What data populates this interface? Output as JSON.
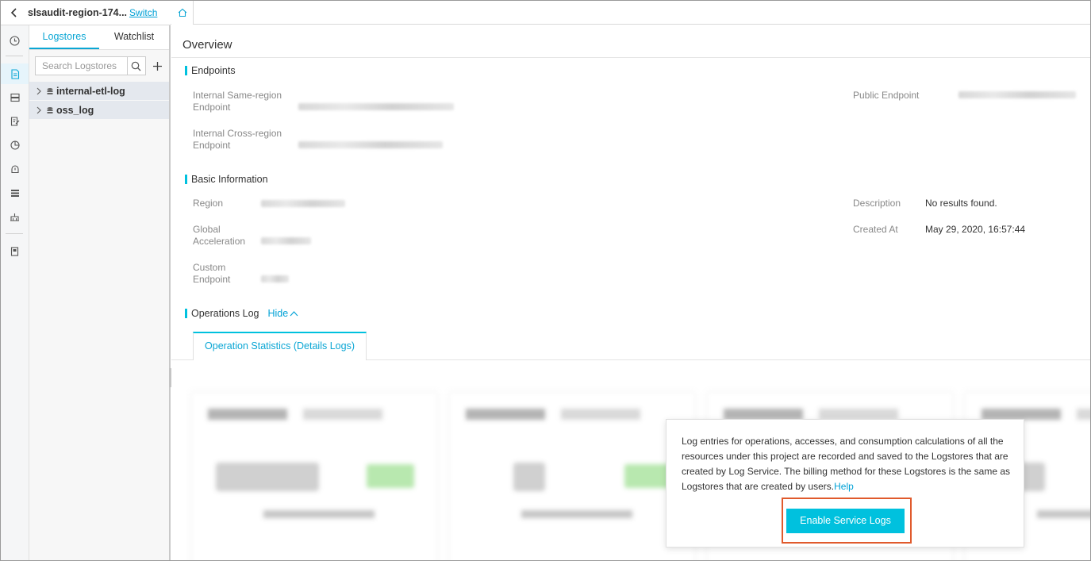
{
  "project": {
    "name": "slsaudit-region-174...",
    "switch_label": "Switch"
  },
  "rail": {
    "icons": [
      "clock-icon",
      "logstore-icon",
      "storage-icon",
      "task-icon",
      "chart-icon",
      "alert-icon",
      "list-icon",
      "gateway-icon",
      "book-icon"
    ]
  },
  "panel": {
    "tabs": [
      "Logstores",
      "Watchlist"
    ],
    "active_tab": "Logstores",
    "search_placeholder": "Search Logstores",
    "logstores": [
      {
        "label": "internal-etl-log"
      },
      {
        "label": "oss_log"
      }
    ]
  },
  "main": {
    "title": "Overview",
    "endpoints": {
      "heading": "Endpoints",
      "internal_same_label_1": "Internal Same-region",
      "internal_same_label_2": "Endpoint",
      "internal_cross_label_1": "Internal Cross-region",
      "internal_cross_label_2": "Endpoint",
      "public_label": "Public Endpoint"
    },
    "basic": {
      "heading": "Basic Information",
      "region_label": "Region",
      "global_label_1": "Global",
      "global_label_2": "Acceleration",
      "custom_label_1": "Custom",
      "custom_label_2": "Endpoint",
      "description_label": "Description",
      "description_value": "No results found.",
      "created_label": "Created At",
      "created_value": "May 29, 2020, 16:57:44"
    },
    "oplog": {
      "heading": "Operations Log",
      "hide_label": "Hide",
      "tab_label": "Operation Statistics (Details Logs)"
    }
  },
  "notice": {
    "text": "Log entries for operations, accesses, and consumption calculations of all the resources under this project are recorded and saved to the Logstores that are created by Log Service. The billing method for these Logstores is the same as Logstores that are created by users.",
    "help_label": "Help",
    "button_label": "Enable Service Logs"
  },
  "colors": {
    "accent": "#00c1de",
    "link": "#00a1d6",
    "highlight": "#e05a2c"
  }
}
